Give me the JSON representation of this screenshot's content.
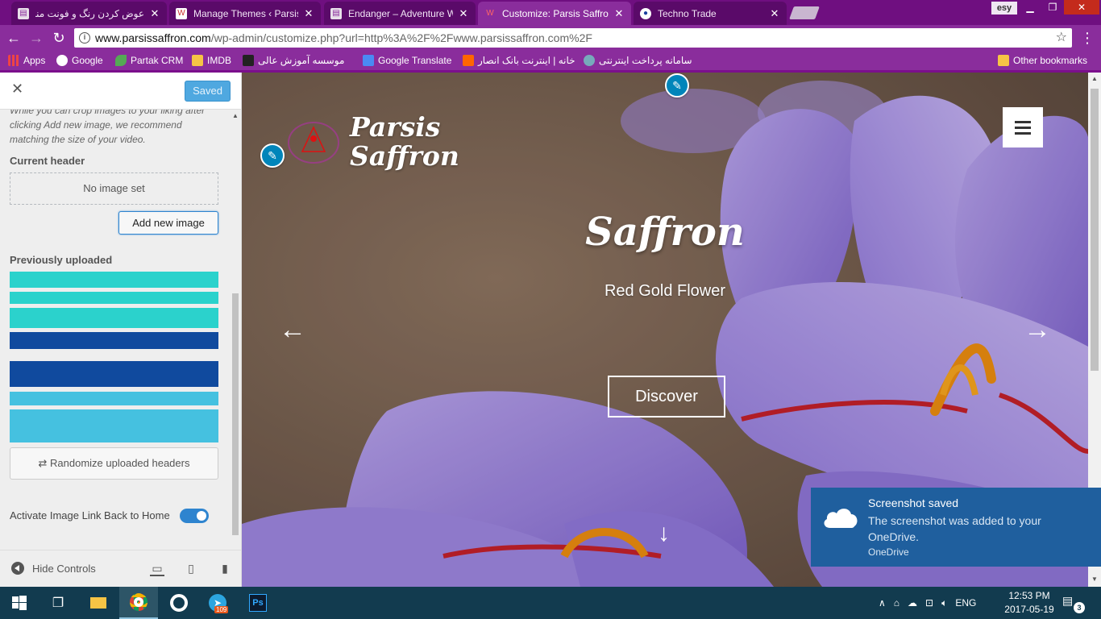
{
  "browser": {
    "tabs": [
      {
        "title": "عوض کردن رنگ و فونت منو",
        "active": false
      },
      {
        "title": "Manage Themes ‹ Parsis",
        "active": false
      },
      {
        "title": "Endanger – Adventure W",
        "active": false
      },
      {
        "title": "Customize: Parsis Saffron",
        "active": true
      },
      {
        "title": "Techno Trade",
        "active": false
      }
    ],
    "profile_label": "esy",
    "url_host": "www.parsissaffron.com",
    "url_path": "/wp-admin/customize.php?url=http%3A%2F%2Fwww.parsissaffron.com%2F",
    "bookmarks": [
      {
        "label": "Apps",
        "icon": "apps-grid-icon",
        "color": "#e44"
      },
      {
        "label": "Google",
        "icon": "google-icon",
        "color": "#fff"
      },
      {
        "label": "Partak CRM",
        "icon": "leaf-icon",
        "color": "#5a5"
      },
      {
        "label": "IMDB",
        "icon": "folder-icon",
        "color": "#f6c445"
      },
      {
        "label": "موسسه آموزش عالی",
        "icon": "bookmark-icon",
        "color": "#222"
      },
      {
        "label": "Google Translate",
        "icon": "translate-icon",
        "color": "#4a8af4"
      },
      {
        "label": "خانه | اینترنت بانک انصار",
        "icon": "bank-icon",
        "color": "#f60"
      },
      {
        "label": "سامانه پرداخت اینترنتی",
        "icon": "payment-icon",
        "color": "#7ab"
      }
    ],
    "other_bookmarks": "Other bookmarks"
  },
  "customizer": {
    "saved_label": "Saved",
    "description": "While you can crop images to your liking after clicking Add new image, we recommend matching the size of your video.",
    "current_header_label": "Current header",
    "no_image_label": "No image set",
    "add_new_image_label": "Add new image",
    "previously_uploaded_label": "Previously uploaded",
    "uploaded_thumbs": [
      {
        "color": "#2bd2cc"
      },
      {
        "color": "#2bd2cc"
      },
      {
        "color": "#2bd2cc"
      },
      {
        "color": "#104a9e"
      },
      {
        "color": "#104a9e"
      },
      {
        "color": "#45c1e0"
      },
      {
        "color": "#45c1e0"
      }
    ],
    "randomize_label": "Randomize uploaded headers",
    "image_link_label": "Activate Image Link Back to Home",
    "image_link_on": true,
    "hide_controls_label": "Hide Controls"
  },
  "preview": {
    "site_title_line1": "Parsis",
    "site_title_line2": "Saffron",
    "hero_title": "Saffron",
    "hero_subtitle": "Red Gold Flower",
    "discover_label": "Discover",
    "logo_text": "Parsis Saffron"
  },
  "toast": {
    "title": "Screenshot saved",
    "body": "The screenshot was added to your OneDrive.",
    "source": "OneDrive"
  },
  "taskbar": {
    "telegram_badge": "109",
    "tray_language": "ENG",
    "time": "12:53 PM",
    "date": "2017-05-19",
    "notification_count": "3"
  }
}
